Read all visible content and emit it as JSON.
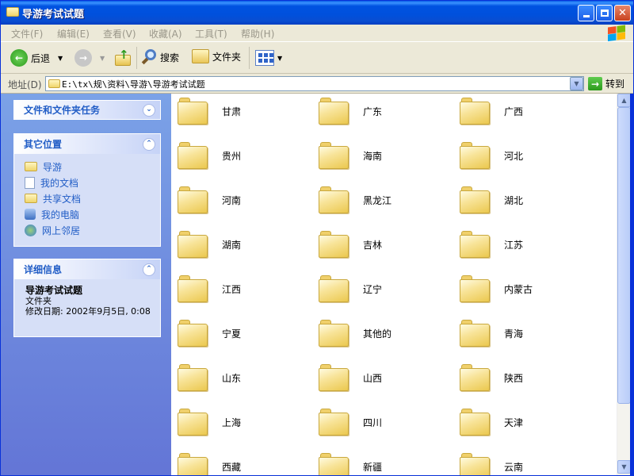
{
  "window": {
    "title": "导游考试试题"
  },
  "menu": [
    "文件(F)",
    "编辑(E)",
    "查看(V)",
    "收藏(A)",
    "工具(T)",
    "帮助(H)"
  ],
  "toolbar": {
    "back_label": "后退",
    "search_label": "搜索",
    "folders_label": "文件夹"
  },
  "address": {
    "label": "地址(D)",
    "path": "E:\\tx\\规\\资料\\导游\\导游考试试题",
    "go_label": "转到"
  },
  "tasks_panel": {
    "title": "文件和文件夹任务"
  },
  "other_places": {
    "title": "其它位置",
    "items": [
      {
        "label": "导游",
        "icon": "folder-icon"
      },
      {
        "label": "我的文档",
        "icon": "documents-icon"
      },
      {
        "label": "共享文档",
        "icon": "folder-icon"
      },
      {
        "label": "我的电脑",
        "icon": "computer-icon"
      },
      {
        "label": "网上邻居",
        "icon": "network-icon"
      }
    ]
  },
  "details": {
    "title": "详细信息",
    "name": "导游考试试题",
    "type": "文件夹",
    "modified": "修改日期: 2002年9月5日, 0:08"
  },
  "folders": [
    "甘肃",
    "广东",
    "广西",
    "贵州",
    "海南",
    "河北",
    "河南",
    "黑龙江",
    "湖北",
    "湖南",
    "吉林",
    "江苏",
    "江西",
    "辽宁",
    "内蒙古",
    "宁夏",
    "其他的",
    "青海",
    "山东",
    "山西",
    "陕西",
    "上海",
    "四川",
    "天津",
    "西藏",
    "新疆",
    "云南"
  ]
}
